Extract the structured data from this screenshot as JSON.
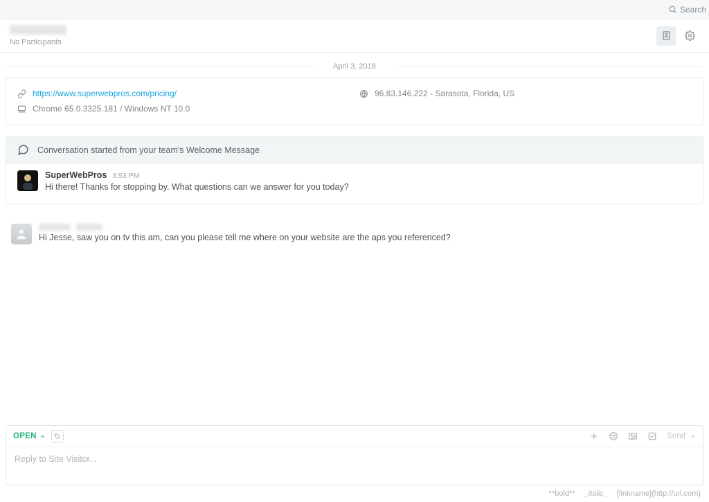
{
  "topbar": {
    "search_label": "Search"
  },
  "header": {
    "participants_label": "No Participants"
  },
  "date_separator": "April 3, 2018",
  "visitor_info": {
    "url": "https://www.superwebpros.com/pricing/",
    "ip_location": "96.83.146.222 - Sarasota, Florida, US",
    "browser": "Chrome 65.0.3325.181 / Windows NT 10.0"
  },
  "conversation_start_banner": "Conversation started from your team's Welcome Message",
  "messages": {
    "welcome": {
      "author": "SuperWebPros",
      "time": "3:53 PM",
      "text": "Hi there! Thanks for stopping by. What questions can we answer for you today?"
    },
    "visitor": {
      "text": "Hi Jesse,   saw you on tv this am, can you please tell me where on your website are the aps you referenced?"
    }
  },
  "composer": {
    "status": "OPEN",
    "placeholder": "Reply to Site Visitor...",
    "send_label": "Send"
  },
  "hints": {
    "bold": "**bold**",
    "italic": "_italic_",
    "link": "[linkname](http://url.com)"
  }
}
